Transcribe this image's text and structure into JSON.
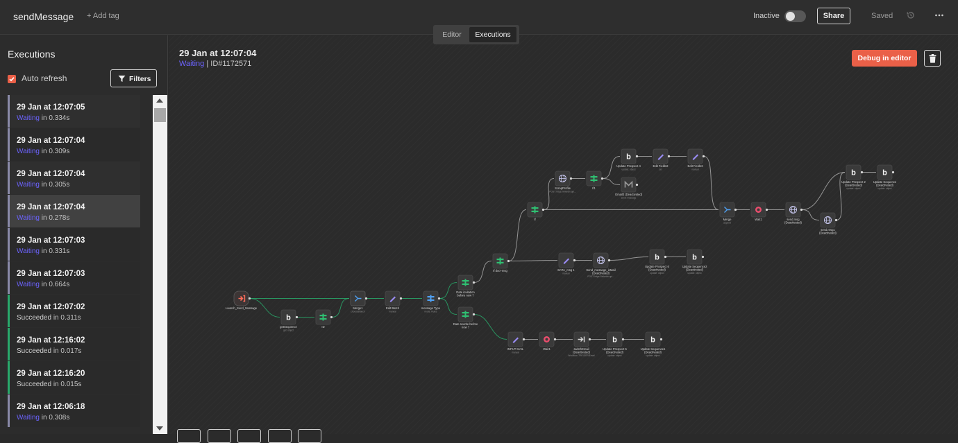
{
  "topbar": {
    "workflow_name": "sendMessage",
    "add_tag": "+ Add tag",
    "status_label": "Inactive",
    "share": "Share",
    "saved": "Saved"
  },
  "tabs": {
    "editor": "Editor",
    "executions": "Executions"
  },
  "sidebar": {
    "title": "Executions",
    "auto_refresh": "Auto refresh",
    "filters": "Filters",
    "items": [
      {
        "time": "29 Jan at 12:07:05",
        "status": "Waiting",
        "duration": "in 0.334s"
      },
      {
        "time": "29 Jan at 12:07:04",
        "status": "Waiting",
        "duration": "in 0.309s"
      },
      {
        "time": "29 Jan at 12:07:04",
        "status": "Waiting",
        "duration": "in 0.305s"
      },
      {
        "time": "29 Jan at 12:07:04",
        "status": "Waiting",
        "duration": "in 0.278s"
      },
      {
        "time": "29 Jan at 12:07:03",
        "status": "Waiting",
        "duration": "in 0.331s"
      },
      {
        "time": "29 Jan at 12:07:03",
        "status": "Waiting",
        "duration": "in 0.664s"
      },
      {
        "time": "29 Jan at 12:07:02",
        "status": "Succeeded",
        "duration": "in 0.311s"
      },
      {
        "time": "29 Jan at 12:16:02",
        "status": "Succeeded",
        "duration": "in 0.017s"
      },
      {
        "time": "29 Jan at 12:16:20",
        "status": "Succeeded",
        "duration": "in 0.015s"
      },
      {
        "time": "29 Jan at 12:06:18",
        "status": "Waiting",
        "duration": "in 0.308s"
      }
    ]
  },
  "execution": {
    "title": "29 Jan at 12:07:04",
    "status": "Waiting",
    "id": "ID#1172571",
    "debug_button": "Debug in editor"
  },
  "colors": {
    "accent": "#ea6048",
    "waiting": "#6c63ff",
    "success": "#29a96b",
    "waiting_bar": "#8a8aa8"
  },
  "workflow_nodes": [
    {
      "id": "launch",
      "label": "Launch_Send_Message",
      "sub": "",
      "icon": "trigger-icon"
    },
    {
      "id": "getseq",
      "label": "getSequence",
      "sub": "get: object",
      "icon": "bubble-icon"
    },
    {
      "id": "ifid",
      "label": "ID",
      "sub": "",
      "icon": "if-icon"
    },
    {
      "id": "merge1",
      "label": "Merge1",
      "sub": "chooseBranch",
      "icon": "merge-icon"
    },
    {
      "id": "editbatch",
      "label": "Edit Batch",
      "sub": "manual",
      "icon": "edit-icon"
    },
    {
      "id": "msgtype",
      "label": "message Type",
      "sub": "mode: Rules",
      "icon": "switch-icon"
    },
    {
      "id": "dateinv",
      "label": "Date invitation before now ?",
      "sub": "",
      "icon": "if-icon"
    },
    {
      "id": "daterem",
      "label": "Date rewrite before now ?",
      "sub": "",
      "icon": "if-icon"
    },
    {
      "id": "ifdoc",
      "label": "If doc+msg",
      "sub": "",
      "icon": "if-icon"
    },
    {
      "id": "if2",
      "label": "If",
      "sub": "",
      "icon": "if-icon"
    },
    {
      "id": "scrap",
      "label": "ScrapProfile",
      "sub": "POST: https://linkedin.api...",
      "icon": "globe-icon"
    },
    {
      "id": "if3",
      "label": "If1",
      "sub": "",
      "icon": "if-icon"
    },
    {
      "id": "upd4",
      "label": "Update Prospect 4",
      "sub": "update: object",
      "icon": "bubble-icon"
    },
    {
      "id": "editf2",
      "label": "Edit Fields2",
      "sub": "set",
      "icon": "edit-icon"
    },
    {
      "id": "editf3",
      "label": "Edit Fields3",
      "sub": "manual",
      "icon": "edit-icon"
    },
    {
      "id": "gmail",
      "label": "Gmail3 (Deactivated)",
      "sub": "send: message",
      "icon": "gmail-icon"
    },
    {
      "id": "merge2",
      "label": "Merge",
      "sub": "append",
      "icon": "merge-icon"
    },
    {
      "id": "wait1",
      "label": "Wait1",
      "sub": "",
      "icon": "wait-icon"
    },
    {
      "id": "sendmsg",
      "label": "send.msg (Deactivated)",
      "sub": "",
      "icon": "globe-icon"
    },
    {
      "id": "sendmsg1",
      "label": "send.msg1 (Deactivated)",
      "sub": "",
      "icon": "globe-icon"
    },
    {
      "id": "upd2",
      "label": "Update Prospect 2 (Deactivated)",
      "sub": "update: object",
      "icon": "bubble-icon"
    },
    {
      "id": "updseq",
      "label": "Update Sequence (Deactivated)",
      "sub": "update: object",
      "icon": "bubble-icon"
    },
    {
      "id": "datamsg",
      "label": "DATA_msg 1",
      "sub": "manual",
      "icon": "edit-icon"
    },
    {
      "id": "sendinmail",
      "label": "Send_message_inMail (Deactivated)",
      "sub": "POST: https://linkedin.api...",
      "icon": "globe-icon"
    },
    {
      "id": "upd6",
      "label": "Update Prospect 6 (Deactivated)",
      "sub": "update: object",
      "icon": "bubble-icon"
    },
    {
      "id": "updseq2",
      "label": "Update Sequence2 (Deactivated)",
      "sub": "update: object",
      "icon": "bubble-icon"
    },
    {
      "id": "inputmail",
      "label": "INPUT MAIL",
      "sub": "manual",
      "icon": "edit-icon"
    },
    {
      "id": "wait",
      "label": "Wait1",
      "sub": "",
      "icon": "wait-icon"
    },
    {
      "id": "switchmail",
      "label": "switchEmail (Deactivated)",
      "sub": "Workflow: TRIGGER/Email",
      "icon": "exec-icon"
    },
    {
      "id": "upd5",
      "label": "Update Prospect 5 (Deactivated)",
      "sub": "update: object",
      "icon": "bubble-icon"
    },
    {
      "id": "updseq1",
      "label": "Update Sequence1 (Deactivated)",
      "sub": "update: object",
      "icon": "bubble-icon"
    }
  ]
}
